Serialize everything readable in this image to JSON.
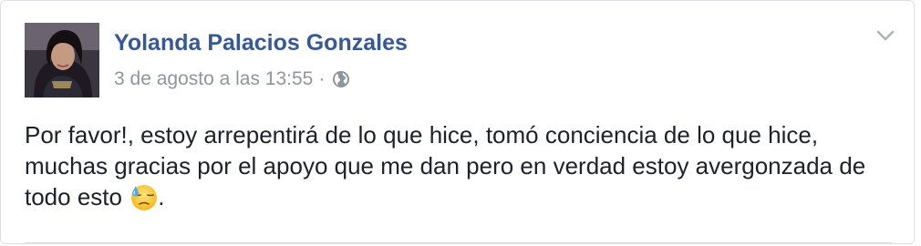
{
  "post": {
    "author_name": "Yolanda Palacios Gonzales",
    "timestamp": "3 de agosto a las 13:55",
    "separator": "·",
    "privacy_icon": "globe-icon",
    "options_icon": "chevron-down-icon",
    "text": "Por favor!, estoy arrepentirá de lo que hice, tomó conciencia de lo que hice, muchas gracias por el apoyo que me dan pero en verdad estoy avergonzada de todo esto",
    "text_suffix": ".",
    "emoji_icon": "downcast-face-with-sweat-emoji"
  },
  "colors": {
    "author_link": "#365899",
    "meta_text": "#90949c",
    "body_text": "#1d2129",
    "card_border": "#dddfe2"
  }
}
